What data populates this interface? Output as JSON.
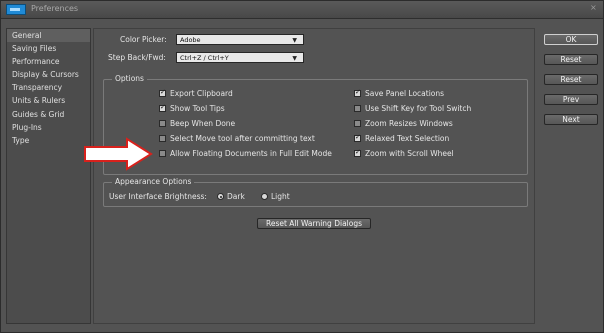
{
  "window": {
    "title": "Preferences",
    "close_glyph": "×",
    "icon": "photoshop-app-icon"
  },
  "sidebar": {
    "items": [
      {
        "label": "General",
        "selected": true
      },
      {
        "label": "Saving Files"
      },
      {
        "label": "Performance"
      },
      {
        "label": "Display & Cursors"
      },
      {
        "label": "Transparency"
      },
      {
        "label": "Units & Rulers"
      },
      {
        "label": "Guides & Grid"
      },
      {
        "label": "Plug-Ins"
      },
      {
        "label": "Type"
      }
    ]
  },
  "fields": {
    "color_picker": {
      "label": "Color Picker:",
      "value": "Adobe"
    },
    "step": {
      "label": "Step Back/Fwd:",
      "value": "Ctrl+Z / Ctrl+Y"
    }
  },
  "options": {
    "title": "Options",
    "left": [
      {
        "label": "Export Clipboard",
        "checked": true
      },
      {
        "label": "Show Tool Tips",
        "checked": true
      },
      {
        "label": "Beep When Done",
        "checked": false
      },
      {
        "label": "Select Move tool after committing text",
        "checked": false
      },
      {
        "label": "Allow Floating Documents in Full Edit Mode",
        "checked": false
      }
    ],
    "right": [
      {
        "label": "Save Panel Locations",
        "checked": true
      },
      {
        "label": "Use Shift Key for Tool Switch",
        "checked": false
      },
      {
        "label": "Zoom Resizes Windows",
        "checked": false
      },
      {
        "label": "Relaxed Text Selection",
        "checked": true
      },
      {
        "label": "Zoom with Scroll Wheel",
        "checked": true
      }
    ]
  },
  "appearance": {
    "title": "Appearance Options",
    "brightness_label": "User Interface Brightness:",
    "options": [
      {
        "label": "Dark",
        "selected": true
      },
      {
        "label": "Light",
        "selected": false
      }
    ]
  },
  "reset_warnings": "Reset All Warning Dialogs",
  "buttons": {
    "ok": "OK",
    "reset": "Reset",
    "reset2": "Reset",
    "prev": "Prev",
    "next": "Next"
  },
  "annotation": {
    "arrow_icon": "red-pointer-arrow-icon",
    "color": "#d8211c"
  }
}
